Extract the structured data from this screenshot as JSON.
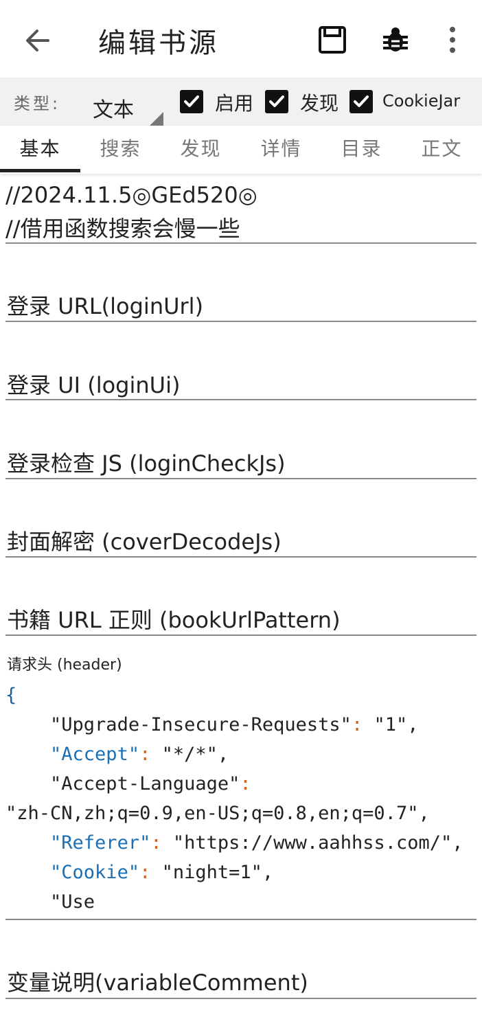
{
  "app_bar": {
    "title": "编辑书源"
  },
  "options": {
    "type_label": "类型:",
    "type_value": "文本",
    "checkboxes": [
      {
        "label": "启用",
        "checked": true
      },
      {
        "label": "发现",
        "checked": true
      },
      {
        "label": "CookieJar",
        "checked": true
      }
    ]
  },
  "tabs": [
    {
      "label": "基本",
      "active": true
    },
    {
      "label": "搜索",
      "active": false
    },
    {
      "label": "发现",
      "active": false
    },
    {
      "label": "详情",
      "active": false
    },
    {
      "label": "目录",
      "active": false
    },
    {
      "label": "正文",
      "active": false
    }
  ],
  "comment": {
    "line1": "//2024.11.5◎GEd520◎",
    "line2": "//借用函数搜索会慢一些"
  },
  "fields": {
    "login_url": "登录 URL(loginUrl)",
    "login_ui": "登录 UI (loginUi)",
    "login_check_js": "登录检查 JS (loginCheckJs)",
    "cover_decode_js": "封面解密 (coverDecodeJs)",
    "book_url_pattern": "书籍 URL 正则 (bookUrlPattern)",
    "header_label": "请求头 (header)",
    "variable_comment": "变量说明(variableComment)"
  },
  "header_code": {
    "open_brace": "{",
    "l1_key": "\"Upgrade-Insecure-Requests\"",
    "l1_val": "\"1\"",
    "l2_key": "\"Accept\"",
    "l2_val": "\"*/*\"",
    "l3_key": "\"Accept-Language\"",
    "l3_val": "\"zh-CN,zh;q=0.9,en-US;q=0.8,en;q=0.7\"",
    "l4_key": "\"Referer\"",
    "l4_val": "\"https://www.aahhss.com/\"",
    "l5_key": "\"Cookie\"",
    "l5_val": "\"night=1\"",
    "l6": "\"Use"
  }
}
